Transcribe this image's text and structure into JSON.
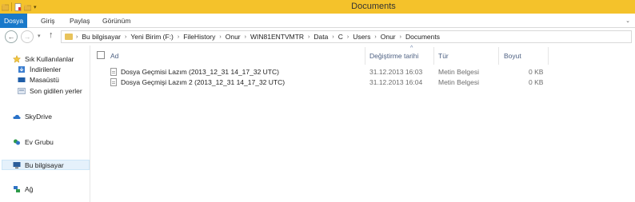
{
  "window": {
    "title": "Documents"
  },
  "ribbon": {
    "tabs": [
      "Dosya",
      "Giriş",
      "Paylaş",
      "Görünüm"
    ],
    "toggle_glyph": "⌄"
  },
  "address": {
    "crumbs": [
      "Bu bilgisayar",
      "Yeni Birim (F:)",
      "FileHistory",
      "Onur",
      "WIN81ENTVMTR",
      "Data",
      "C",
      "Users",
      "Onur",
      "Documents"
    ]
  },
  "navpane": {
    "favorites": {
      "label": "Sık Kullanılanlar",
      "items": [
        "İndirilenler",
        "Masaüstü",
        "Son gidilen yerler"
      ]
    },
    "skydrive": "SkyDrive",
    "homegroup": "Ev Grubu",
    "computer": "Bu bilgisayar",
    "network": "Ağ"
  },
  "columns": {
    "name": "Ad",
    "modified": "Değiştirme tarihi",
    "type": "Tür",
    "size": "Boyut"
  },
  "files": [
    {
      "name": "Dosya Geçmisi Lazım (2013_12_31 14_17_32 UTC)",
      "modified": "31.12.2013 16:03",
      "type": "Metin Belgesi",
      "size": "0 KB"
    },
    {
      "name": "Dosya Geçmişi Lazım 2 (2013_12_31 14_17_32 UTC)",
      "modified": "31.12.2013 16:04",
      "type": "Metin Belgesi",
      "size": "0 KB"
    }
  ],
  "colors": {
    "titlebar": "#f4c22b",
    "file_tab": "#1979ca",
    "selection": "#e5f1fb"
  }
}
